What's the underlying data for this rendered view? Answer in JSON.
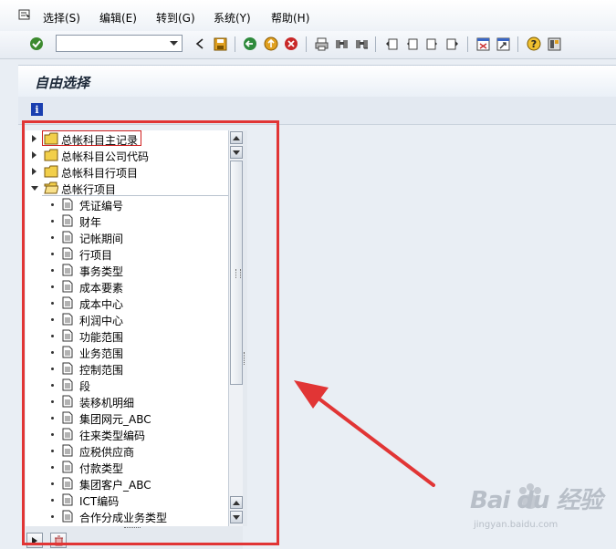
{
  "menubar": {
    "items": [
      {
        "label": "选择(S)",
        "name": "menu-select"
      },
      {
        "label": "编辑(E)",
        "name": "menu-edit"
      },
      {
        "label": "转到(G)",
        "name": "menu-goto"
      },
      {
        "label": "系统(Y)",
        "name": "menu-system"
      },
      {
        "label": "帮助(H)",
        "name": "menu-help"
      }
    ]
  },
  "toolbar": {
    "command_value": "",
    "buttons": [
      "enter-check-icon",
      "back-icon",
      "save-icon",
      "back-green-icon",
      "exit-icon",
      "cancel-icon",
      "print-icon",
      "find-icon",
      "find-next-icon",
      "first-page-icon",
      "previous-page-icon",
      "next-page-icon",
      "last-page-icon",
      "new-session-icon",
      "shortcut-icon",
      "help-icon",
      "layout-icon"
    ]
  },
  "page": {
    "title": "自由选择"
  },
  "tree": {
    "nodes": [
      {
        "label": "总帐科目主记录",
        "type": "folder",
        "state": "collapsed",
        "level": 0,
        "selected": true
      },
      {
        "label": "总帐科目公司代码",
        "type": "folder",
        "state": "collapsed",
        "level": 0
      },
      {
        "label": "总帐科目行项目",
        "type": "folder",
        "state": "collapsed",
        "level": 0
      },
      {
        "label": "总帐行项目",
        "type": "folder",
        "state": "expanded",
        "level": 0
      },
      {
        "label": "凭证编号",
        "type": "field",
        "level": 1
      },
      {
        "label": "财年",
        "type": "field",
        "level": 1
      },
      {
        "label": "记帐期间",
        "type": "field",
        "level": 1
      },
      {
        "label": "行项目",
        "type": "field",
        "level": 1
      },
      {
        "label": "事务类型",
        "type": "field",
        "level": 1
      },
      {
        "label": "成本要素",
        "type": "field",
        "level": 1
      },
      {
        "label": "成本中心",
        "type": "field",
        "level": 1
      },
      {
        "label": "利润中心",
        "type": "field",
        "level": 1
      },
      {
        "label": "功能范围",
        "type": "field",
        "level": 1
      },
      {
        "label": "业务范围",
        "type": "field",
        "level": 1
      },
      {
        "label": "控制范围",
        "type": "field",
        "level": 1
      },
      {
        "label": "段",
        "type": "field",
        "level": 1
      },
      {
        "label": "装移机明细",
        "type": "field",
        "level": 1
      },
      {
        "label": "集团网元_ABC",
        "type": "field",
        "level": 1
      },
      {
        "label": "往来类型编码",
        "type": "field",
        "level": 1
      },
      {
        "label": "应税供应商",
        "type": "field",
        "level": 1
      },
      {
        "label": "付款类型",
        "type": "field",
        "level": 1
      },
      {
        "label": "集团客户_ABC",
        "type": "field",
        "level": 1
      },
      {
        "label": "ICT编码",
        "type": "field",
        "level": 1
      },
      {
        "label": "合作分成业务类型",
        "type": "field",
        "level": 1
      }
    ]
  },
  "colors": {
    "annotation": "#e13535",
    "selection_border": "#d02020",
    "folder": "#f2cf4a"
  },
  "watermark": {
    "brand": "Bai du 经验",
    "url": "jingyan.baidu.com"
  }
}
